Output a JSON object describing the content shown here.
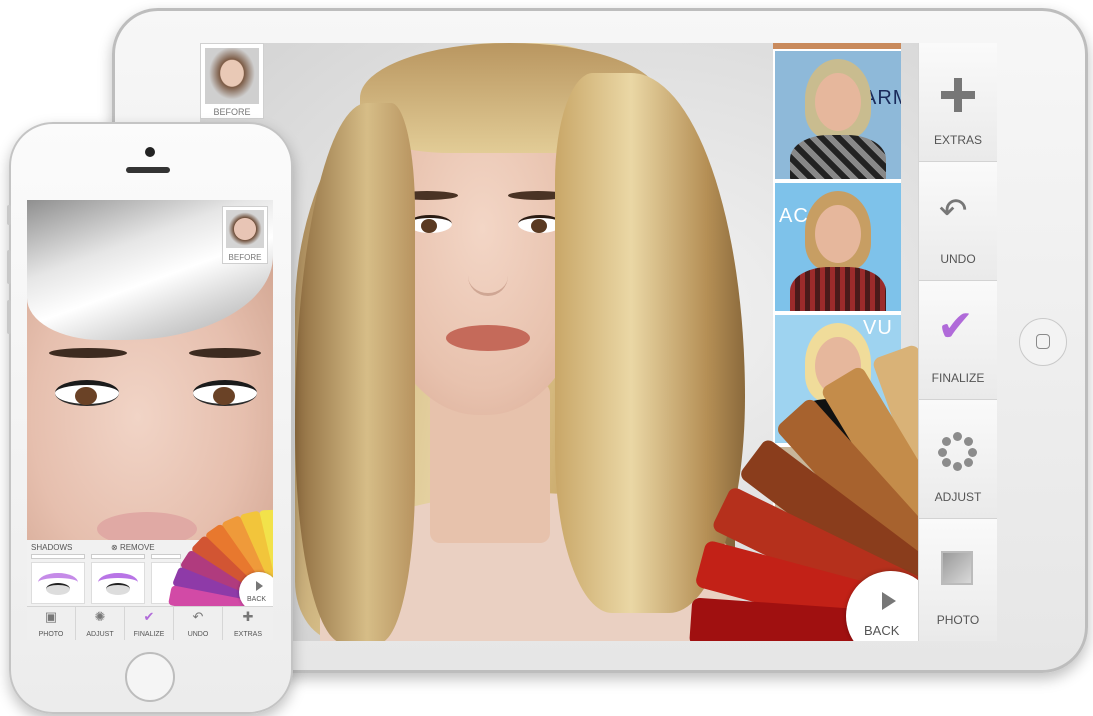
{
  "tablet": {
    "before_label": "BEFORE",
    "back_label": "BACK",
    "toolbar": [
      {
        "label": "EXTRAS",
        "icon": "plus-icon"
      },
      {
        "label": "UNDO",
        "icon": "undo-icon"
      },
      {
        "label": "FINALIZE",
        "icon": "check-icon"
      },
      {
        "label": "ADJUST",
        "icon": "dots-circle-icon"
      },
      {
        "label": "PHOTO",
        "icon": "photo-icon"
      }
    ],
    "strip_text": [
      "ARMA",
      "AC",
      "VU"
    ],
    "hair_colors": [
      "#f0e2c0",
      "#e8cf9c",
      "#d9b277",
      "#c48c4a",
      "#a7622e",
      "#8a3d1c",
      "#b5301c",
      "#c22117",
      "#a01010"
    ]
  },
  "phone": {
    "before_label": "BEFORE",
    "panel": {
      "shadows_label": "SHADOWS",
      "remove_label": "REMOVE"
    },
    "back_label": "BACK",
    "toolbar": [
      {
        "label": "PHOTO",
        "icon": "photo-icon"
      },
      {
        "label": "ADJUST",
        "icon": "dots-circle-icon"
      },
      {
        "label": "FINALIZE",
        "icon": "check-icon"
      },
      {
        "label": "UNDO",
        "icon": "undo-icon"
      },
      {
        "label": "EXTRAS",
        "icon": "plus-icon"
      }
    ],
    "shadow_colors": [
      "#f2e24a",
      "#f2c53b",
      "#ef9a3a",
      "#e8782e",
      "#d25533",
      "#b03b7e",
      "#8e3aa8",
      "#d24aa6"
    ]
  }
}
